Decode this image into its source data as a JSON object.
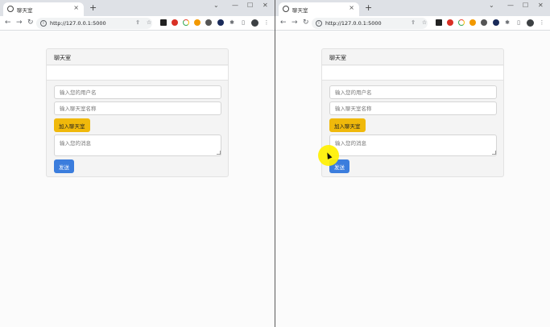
{
  "colors": {
    "join_button_bg": "#f0b90b",
    "send_button_bg": "#3b7ddd",
    "card_bg": "#f4f4f4",
    "cursor_highlight": "#fff000"
  },
  "browser": {
    "tab_title": "聊天室",
    "tab_close": "×",
    "new_tab": "+",
    "url": "http://127.0.0.1:5000",
    "back": "←",
    "forward": "→",
    "reload": "↻",
    "info": "i",
    "share": "⇪",
    "bookmark": "☆",
    "extensions": "✱",
    "side_panel": "▯",
    "menu": "⋮",
    "minimize": "—",
    "maximize": "☐",
    "close": "✕"
  },
  "windows": [
    {
      "card_title": "聊天室",
      "username_placeholder": "输入您的用户名",
      "room_placeholder": "输入聊天室名称",
      "join_label": "加入聊天室",
      "message_placeholder": "输入您的消息",
      "send_label": "发送"
    },
    {
      "card_title": "聊天室",
      "username_placeholder": "输入您的用户名",
      "room_placeholder": "输入聊天室名称",
      "join_label": "加入聊天室",
      "message_placeholder": "输入您的消息",
      "send_label": "发送"
    }
  ]
}
